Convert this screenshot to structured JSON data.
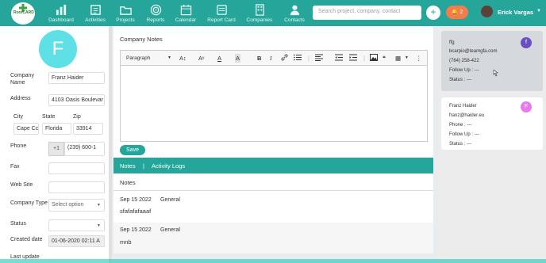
{
  "nav": {
    "logo_text": "RoofCARD",
    "items": [
      {
        "label": "Dashboard",
        "icon": "dashboard-icon"
      },
      {
        "label": "Activities",
        "icon": "activities-icon"
      },
      {
        "label": "Projects",
        "icon": "folder-icon"
      },
      {
        "label": "Reports",
        "icon": "target-icon"
      },
      {
        "label": "Calendar",
        "icon": "calendar-icon"
      },
      {
        "label": "Report Card",
        "icon": "report-card-icon"
      },
      {
        "label": "Companies",
        "icon": "building-icon"
      },
      {
        "label": "Contacts",
        "icon": "person-icon"
      }
    ],
    "search_placeholder": "Search project, company, contact",
    "plus_icon": "+",
    "notif_count": "2",
    "user_name": "Erick Vargas",
    "accent": "#26a69a"
  },
  "company": {
    "avatar_letter": "F",
    "labels": {
      "company_name": "Company Name",
      "address": "Address",
      "city": "City",
      "state": "State",
      "zip": "Zip",
      "phone": "Phone",
      "fax": "Fax",
      "website": "Web Site",
      "company_type": "Company Type",
      "status": "Status",
      "created_date": "Created date",
      "last_update": "Last update"
    },
    "values": {
      "company_name": "Franz Haider",
      "address": "4103 Oasis Boulevar",
      "city": "Cape Cc",
      "state": "Florida",
      "zip": "33914",
      "phone_prefix": "+1",
      "phone": "(239) 600-1",
      "fax": "",
      "website": "",
      "company_type": "Select option",
      "status": "",
      "created_date": "01-06-2020 02:11 A"
    }
  },
  "notes_panel": {
    "title": "Company Notes",
    "paragraph_label": "Paragraph",
    "toolbar_glyphs": {
      "font_size": "A↕",
      "font_family": "Aᵛ",
      "font_color": "A",
      "highlight": "A",
      "bold": "B",
      "italic": "I",
      "link": "🔗",
      "list": "☰",
      "align": "≡",
      "quote": "❝",
      "table": "▦"
    },
    "save_label": "Save",
    "tab_notes": "Notes",
    "tab_sep": "|",
    "tab_activity": "Activity Logs",
    "list_title": "Notes",
    "notes": [
      {
        "date": "Sep 15 2022",
        "type": "General",
        "text": "sfafafafaaaf"
      },
      {
        "date": "Sep 15 2022",
        "type": "General",
        "text": "mnb"
      }
    ]
  },
  "contacts": [
    {
      "name": "ffg",
      "email": "bcarpio@teamgfa.com",
      "phone": "(764) 258-422",
      "follow_up": "Follow Up : ---",
      "status": "Status : ---",
      "avatar_letter": "f",
      "avatar_color": "#6a4fc2"
    },
    {
      "name": "Franz Haider",
      "email": "franz@haider.eu",
      "phone": "Phone : ---",
      "follow_up": "Follow Up : ---",
      "status": "Status : ---",
      "avatar_letter": "F",
      "avatar_color": "#e879f0"
    }
  ]
}
